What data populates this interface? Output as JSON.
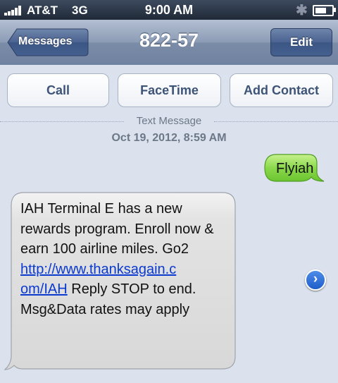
{
  "status_bar": {
    "carrier": "AT&T",
    "network": "3G",
    "time": "9:00 AM",
    "signal_bars": 5,
    "battery_level": 0.85
  },
  "nav": {
    "back_label": "Messages",
    "title": "822-57",
    "edit_label": "Edit"
  },
  "actions": {
    "call_label": "Call",
    "facetime_label": "FaceTime",
    "add_contact_label": "Add Contact"
  },
  "conversation": {
    "type_label": "Text Message",
    "date_label": "Oct 19, 2012, 8:59 AM",
    "messages": [
      {
        "direction": "outgoing",
        "text": "Flyiah"
      },
      {
        "direction": "incoming",
        "text_before_link": "IAH Terminal E has a new rewards program. Enroll now & earn 100 airline miles. Go2 ",
        "link_line1": "http://www.thanksagain.c",
        "link_line2": "om/IAH",
        "text_after_link": " Reply STOP to end.\nMsg&Data rates may apply"
      }
    ]
  },
  "icons": {
    "bluetooth": "bluetooth-icon",
    "detail": "disclosure-chevron-icon"
  },
  "colors": {
    "outgoing_bubble": "#7fd33f",
    "incoming_bubble": "#e5e5e5",
    "background": "#dbe2ed",
    "link": "#0a3ad0"
  }
}
